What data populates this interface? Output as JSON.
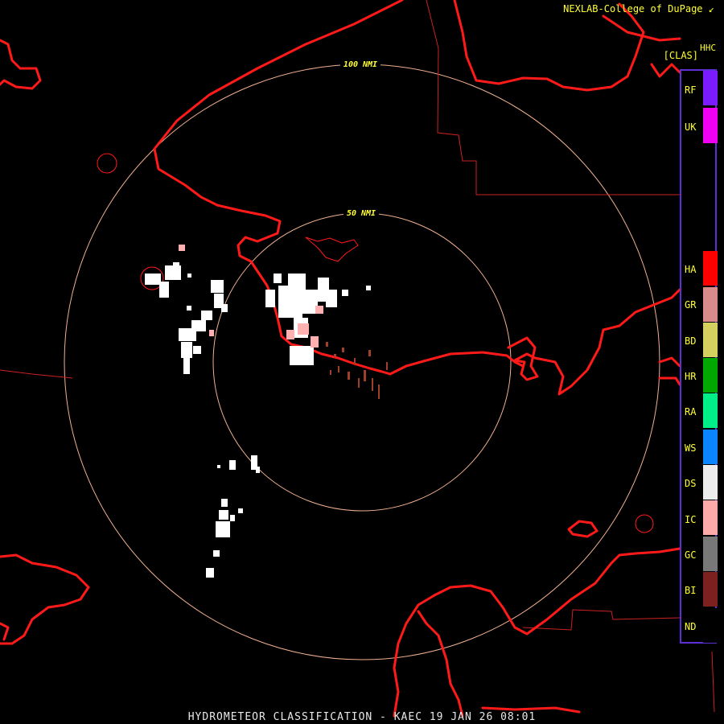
{
  "header": {
    "credit": "NEXLAB-College of DuPage",
    "credit_mark": "↙",
    "product_code": "HHC",
    "product_class": "[CLAS]"
  },
  "rings": [
    {
      "label": "50 NMI"
    },
    {
      "label": "100 NMI"
    }
  ],
  "footer": {
    "title": "HYDROMETEOR CLASSIFICATION - KAEC 19 JAN 26 08:01"
  },
  "legend": {
    "entries": [
      {
        "code": "RF",
        "color": "#7a1cff"
      },
      {
        "code": "UK",
        "color": "#f000f0"
      },
      {
        "code": "HA",
        "color": "#ff0000"
      },
      {
        "code": "GR",
        "color": "#d98a8a"
      },
      {
        "code": "BD",
        "color": "#d4d060"
      },
      {
        "code": "HR",
        "color": "#00a800"
      },
      {
        "code": "RA",
        "color": "#00ee88"
      },
      {
        "code": "WS",
        "color": "#0a84ff"
      },
      {
        "code": "DS",
        "color": "#ececec"
      },
      {
        "code": "IC",
        "color": "#ffaaaa"
      },
      {
        "code": "GC",
        "color": "#787878"
      },
      {
        "code": "BI",
        "color": "#7d2020"
      },
      {
        "code": "ND",
        "color": "#000000"
      }
    ],
    "frame_color": "#5d2fd6"
  },
  "colors": {
    "coastline": "#ff1a1a",
    "boundary": "#cc2222",
    "range_ring": "#f0b090",
    "ring_label": "#ffff33",
    "dry_snow": "#ffffff",
    "ice_crystals": "#ffb0b0",
    "big_drops_bi": "#a0402a"
  },
  "icons": {
    "credit_mark": "arrow-corner-icon"
  }
}
